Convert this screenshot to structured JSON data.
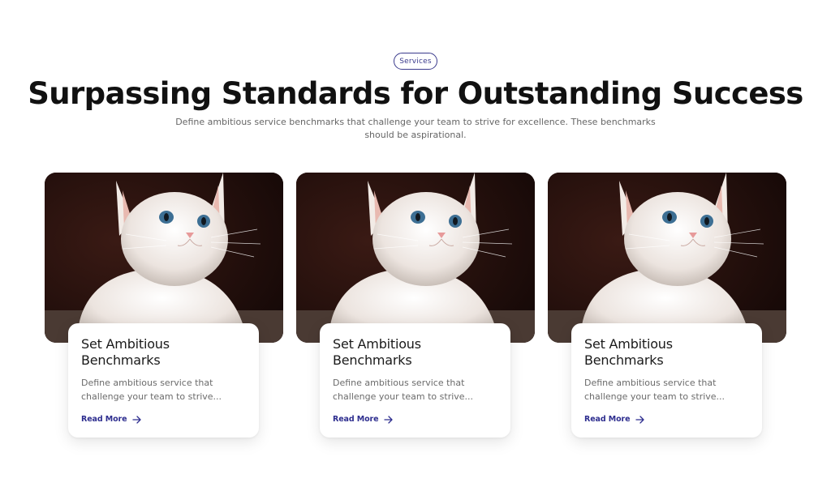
{
  "section": {
    "badge": "Services",
    "title": "Surpassing Standards for Outstanding Success",
    "subtitle": "Define ambitious service benchmarks that challenge your team to strive for excellence. These benchmarks should be aspirational."
  },
  "cards": [
    {
      "title": "Set Ambitious Benchmarks",
      "description": "Define ambitious service that challenge your team to strive...",
      "link_label": "Read More",
      "image_icon": "kitten-photo"
    },
    {
      "title": "Set Ambitious Benchmarks",
      "description": "Define ambitious service that challenge your team to strive...",
      "link_label": "Read More",
      "image_icon": "kitten-photo"
    },
    {
      "title": "Set Ambitious Benchmarks",
      "description": "Define ambitious service that challenge your team to strive...",
      "link_label": "Read More",
      "image_icon": "kitten-photo"
    }
  ],
  "colors": {
    "accent": "#2e2e8f",
    "badge_border": "#3a3a8c",
    "photo_background": "#1c0d0b"
  }
}
